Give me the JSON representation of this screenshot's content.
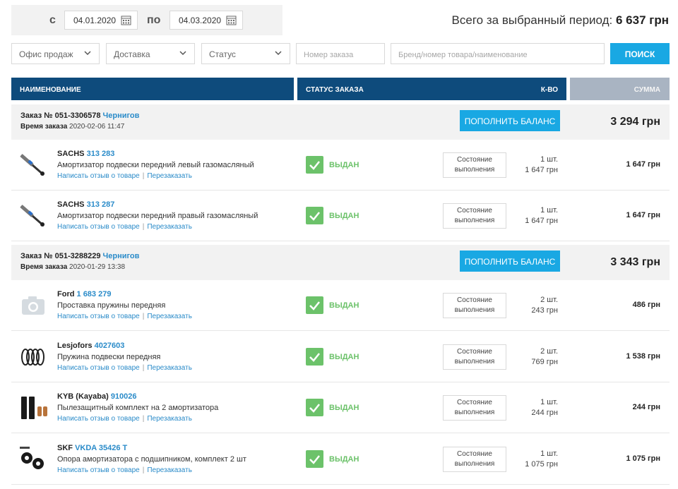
{
  "filters": {
    "from_label": "с",
    "from_date": "04.01.2020",
    "to_label": "по",
    "to_date": "04.03.2020",
    "total_label": "Всего за выбранный период:",
    "total_value": "6 637 грн",
    "office_select": "Офис продаж",
    "delivery_select": "Доставка",
    "status_select": "Статус",
    "order_placeholder": "Номер заказа",
    "product_placeholder": "Бренд/номер товара/наименование",
    "search_label": "ПОИСК"
  },
  "table_header": {
    "name": "НАИМЕНОВАНИЕ",
    "status": "СТАТУС ЗАКАЗА",
    "qty": "К-ВО",
    "sum": "СУММА"
  },
  "orders": [
    {
      "number_label": "Заказ № 051-3306578",
      "city": "Чернигов",
      "time_label": "Время заказа",
      "time": "2020-02-06 11:47",
      "topup_label": "ПОПОЛНИТЬ БАЛАНС",
      "sum": "3 294 грн",
      "items": [
        {
          "brand": "SACHS",
          "article": "313 283",
          "desc": "Амортизатор подвески передний левый газомасляный",
          "review": "Написать отзыв о товаре",
          "reorder": "Перезаказать",
          "status": "ВЫДАН",
          "state_label": "Состояние выполнения",
          "qty": "1 шт.",
          "price": "1 647 грн",
          "sum": "1 647 грн",
          "thumb": "shock-absorber-image"
        },
        {
          "brand": "SACHS",
          "article": "313 287",
          "desc": "Амортизатор подвески передний правый газомасляный",
          "review": "Написать отзыв о товаре",
          "reorder": "Перезаказать",
          "status": "ВЫДАН",
          "state_label": "Состояние выполнения",
          "qty": "1 шт.",
          "price": "1 647 грн",
          "sum": "1 647 грн",
          "thumb": "shock-absorber-image"
        }
      ]
    },
    {
      "number_label": "Заказ № 051-3288229",
      "city": "Чернигов",
      "time_label": "Время заказа",
      "time": "2020-01-29 13:38",
      "topup_label": "ПОПОЛНИТЬ БАЛАНС",
      "sum": "3 343 грн",
      "items": [
        {
          "brand": "Ford",
          "article": "1 683 279",
          "desc": "Проставка пружины передняя",
          "review": "Написать отзыв о товаре",
          "reorder": "Перезаказать",
          "status": "ВЫДАН",
          "state_label": "Состояние выполнения",
          "qty": "2 шт.",
          "price": "243 грн",
          "sum": "486 грн",
          "thumb": "camera-icon"
        },
        {
          "brand": "Lesjofors",
          "article": "4027603",
          "desc": "Пружина подвески передняя",
          "review": "Написать отзыв о товаре",
          "reorder": "Перезаказать",
          "status": "ВЫДАН",
          "state_label": "Состояние выполнения",
          "qty": "2 шт.",
          "price": "769 грн",
          "sum": "1 538 грн",
          "thumb": "spring-image"
        },
        {
          "brand": "KYB (Kayaba)",
          "article": "910026",
          "desc": "Пылезащитный комплект на 2 амортизатора",
          "review": "Написать отзыв о товаре",
          "reorder": "Перезаказать",
          "status": "ВЫДАН",
          "state_label": "Состояние выполнения",
          "qty": "1 шт.",
          "price": "244 грн",
          "sum": "244 грн",
          "thumb": "dust-kit-image"
        },
        {
          "brand": "SKF",
          "article": "VKDA 35426 T",
          "desc": "Опора амортизатора с подшипником, комплект 2 шт",
          "review": "Написать отзыв о товаре",
          "reorder": "Перезаказать",
          "status": "ВЫДАН",
          "state_label": "Состояние выполнения",
          "qty": "1 шт.",
          "price": "1 075 грн",
          "sum": "1 075 грн",
          "thumb": "strut-mount-image"
        }
      ]
    }
  ],
  "colors": {
    "header_blue": "#0e4b7c",
    "accent_blue": "#19a8e3",
    "link_blue": "#2a8bc9",
    "status_green": "#6cc26a"
  }
}
